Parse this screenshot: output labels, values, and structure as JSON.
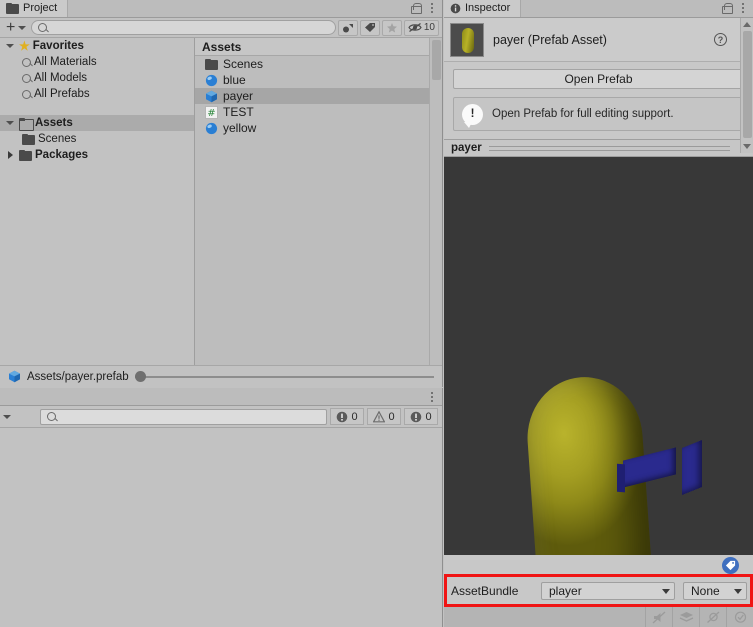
{
  "project": {
    "tab_label": "Project",
    "tab_icon": "folder-icon",
    "lock_icon": "lock-icon",
    "menu_icon": "kebab-menu-icon",
    "toolbar": {
      "create_label": "+",
      "create_icon": "plus-icon",
      "create_dropdown_icon": "chevron-down-icon",
      "search_placeholder": "",
      "search_value": "",
      "search_icon": "search-icon",
      "filter_type_icon": "filter-by-type-icon",
      "filter_label_icon": "filter-by-label-icon",
      "filter_favorite_icon": "filter-favorite-star-icon",
      "hidden_count_icon": "eye-off-icon",
      "hidden_count": "10"
    },
    "tree": [
      {
        "label": "Favorites",
        "icon": "star-icon",
        "depth": 0,
        "expanded": true,
        "bold": true,
        "selected": false
      },
      {
        "label": "All Materials",
        "icon": "search-icon",
        "depth": 1,
        "bold": false,
        "selected": false
      },
      {
        "label": "All Models",
        "icon": "search-icon",
        "depth": 1,
        "bold": false,
        "selected": false
      },
      {
        "label": "All Prefabs",
        "icon": "search-icon",
        "depth": 1,
        "bold": false,
        "selected": false
      },
      {
        "label": "Assets",
        "icon": "folder-outline-icon",
        "depth": 0,
        "expanded": true,
        "bold": true,
        "selected": true
      },
      {
        "label": "Scenes",
        "icon": "folder-icon",
        "depth": 1,
        "bold": false,
        "selected": false
      },
      {
        "label": "Packages",
        "icon": "folder-icon",
        "depth": 0,
        "expanded": false,
        "bold": true,
        "selected": false
      }
    ],
    "list_header": "Assets",
    "items": [
      {
        "label": "Scenes",
        "icon": "folder-icon",
        "selected": false
      },
      {
        "label": "blue",
        "icon": "material-sphere-icon",
        "selected": false
      },
      {
        "label": "payer",
        "icon": "prefab-cube-icon",
        "selected": true
      },
      {
        "label": "TEST",
        "icon": "shader-hash-icon",
        "selected": false
      },
      {
        "label": "yellow",
        "icon": "material-sphere-icon",
        "selected": false
      }
    ],
    "footer": {
      "path_icon": "prefab-cube-icon",
      "path": "Assets/payer.prefab",
      "zoom_slider_icon": "zoom-slider"
    }
  },
  "console": {
    "menu_icon": "kebab-menu-icon",
    "clear_dropdown_icon": "chevron-down-icon",
    "search_placeholder": "",
    "search_value": "",
    "search_icon": "search-icon",
    "counters": [
      {
        "icon": "error-icon",
        "value": "0"
      },
      {
        "icon": "warning-icon",
        "value": "0"
      },
      {
        "icon": "info-icon",
        "value": "0"
      }
    ]
  },
  "inspector": {
    "tab_label": "Inspector",
    "tab_icon": "info-circle-icon",
    "lock_icon": "lock-icon",
    "menu_icon": "kebab-menu-icon",
    "asset_title": "payer (Prefab Asset)",
    "thumbnail_icon": "prefab-preview-thumbnail",
    "help_icon": "help-circle-icon",
    "asset_menu_icon": "kebab-menu-icon",
    "open_prefab_label": "Open Prefab",
    "help_box": {
      "icon": "info-bubble-icon",
      "text": "Open Prefab for full editing support."
    },
    "preview": {
      "name": "payer",
      "menu_icon": "kebab-menu-icon",
      "grip_icon": "drag-handle-icon",
      "background_color": "#383838",
      "capsule_color": "#a49e22",
      "block_color": "#2a2a8e"
    },
    "footer": {
      "tag_badge_icon": "asset-label-tag-icon",
      "assetbundle_label": "AssetBundle",
      "assetbundle_name": "player",
      "assetbundle_variant": "None",
      "dropdown_icon": "chevron-down-icon",
      "highlight_color": "#f01414"
    }
  },
  "statusbar": {
    "buttons": [
      {
        "icon": "mute-audio-icon"
      },
      {
        "icon": "layers-icon"
      },
      {
        "icon": "lighting-off-icon"
      },
      {
        "icon": "check-circle-icon"
      }
    ]
  }
}
